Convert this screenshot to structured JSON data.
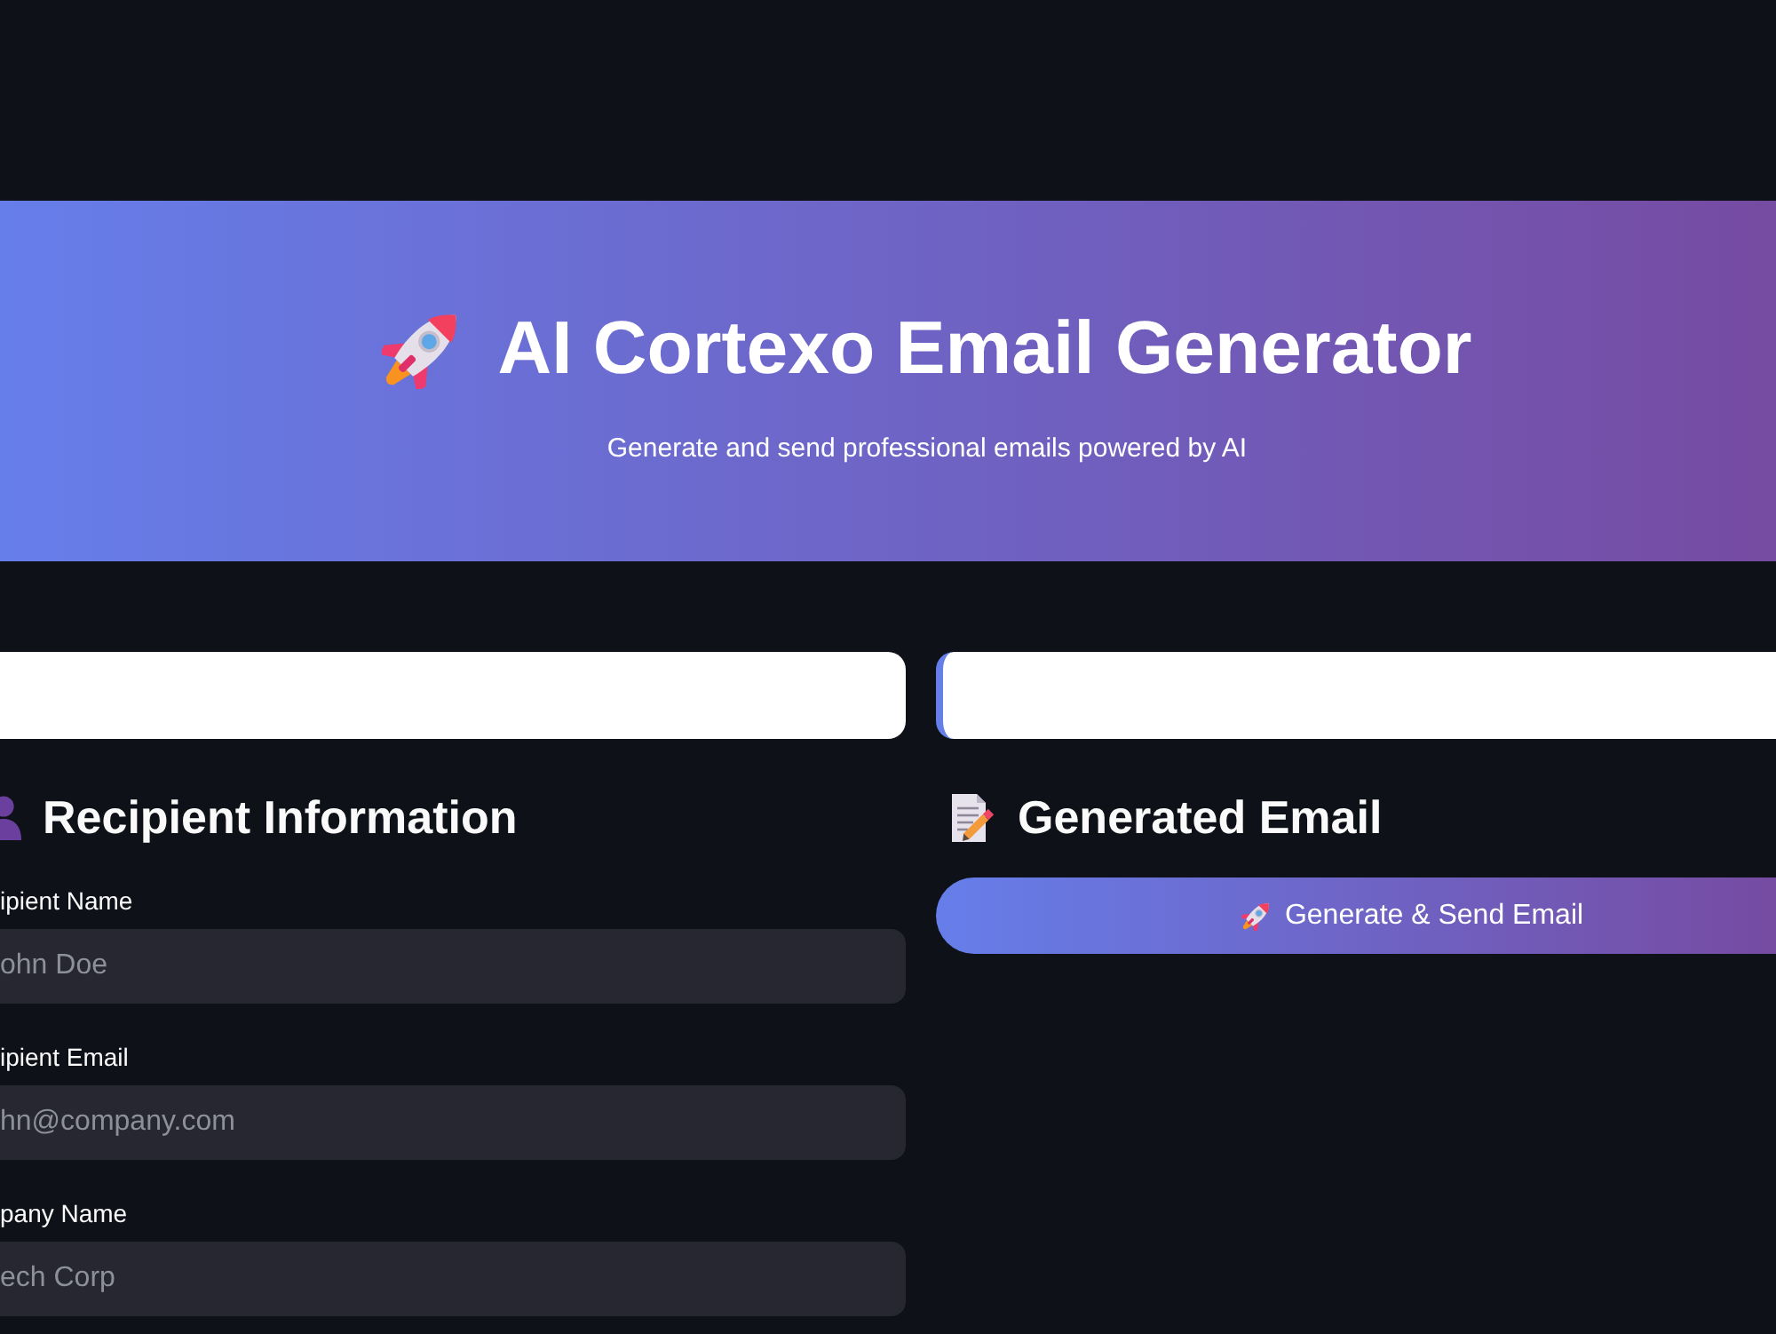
{
  "header": {
    "title": "AI Cortexo Email Generator",
    "subtitle": "Generate and send professional emails powered by AI"
  },
  "columns": [
    {
      "kind": "form",
      "heading": "Recipient Information",
      "fields": [
        {
          "label": "ipient Name",
          "placeholder": "ohn Doe"
        },
        {
          "label": "ipient Email",
          "placeholder": "hn@company.com"
        },
        {
          "label": "pany Name",
          "placeholder": "ech Corp"
        }
      ]
    },
    {
      "kind": "output",
      "heading": "Generated Email",
      "button": {
        "label": "Generate & Send Email"
      }
    }
  ]
}
